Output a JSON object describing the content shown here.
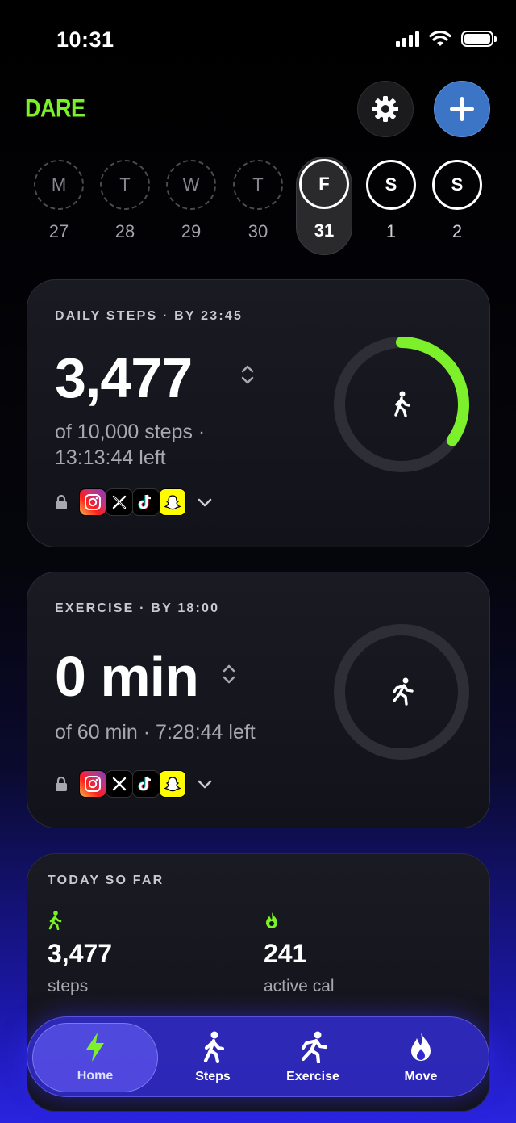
{
  "status_bar": {
    "time": "10:31"
  },
  "header": {
    "brand": "DARE",
    "settings_icon": "gear-icon",
    "add_icon": "plus-icon",
    "accent": "#7cf02a"
  },
  "week": [
    {
      "letter": "M",
      "date": "27",
      "state": "past"
    },
    {
      "letter": "T",
      "date": "28",
      "state": "past"
    },
    {
      "letter": "W",
      "date": "29",
      "state": "past"
    },
    {
      "letter": "T",
      "date": "30",
      "state": "past"
    },
    {
      "letter": "F",
      "date": "31",
      "state": "selected"
    },
    {
      "letter": "S",
      "date": "1",
      "state": "future"
    },
    {
      "letter": "S",
      "date": "2",
      "state": "future"
    }
  ],
  "daily_steps": {
    "label": "DAILY STEPS · BY 23:45",
    "value": "3,477",
    "sub_line1": "of 10,000 steps ·",
    "sub_line2": "13:13:44 left",
    "progress": 0.3477,
    "ring_color": "#7cf02a",
    "icon": "walking-icon",
    "blocked_apps": [
      "instagram",
      "x",
      "tiktok",
      "snapchat"
    ]
  },
  "exercise": {
    "label": "EXERCISE · BY 18:00",
    "value": "0 min",
    "sub_line1": "of 60 min · 7:28:44 left",
    "progress": 0,
    "icon": "running-icon",
    "blocked_apps": [
      "instagram",
      "x",
      "tiktok",
      "snapchat"
    ]
  },
  "today": {
    "label": "TODAY SO FAR",
    "steps": {
      "value": "3,477",
      "unit": "steps",
      "icon": "walking-icon"
    },
    "active_cal": {
      "value": "241",
      "unit": "active cal",
      "icon": "flame-icon"
    }
  },
  "tabs": [
    {
      "label": "Home",
      "icon": "bolt-icon",
      "active": true
    },
    {
      "label": "Steps",
      "icon": "walking-icon",
      "active": false
    },
    {
      "label": "Exercise",
      "icon": "running-icon",
      "active": false
    },
    {
      "label": "Move",
      "icon": "flame-icon",
      "active": false
    }
  ]
}
